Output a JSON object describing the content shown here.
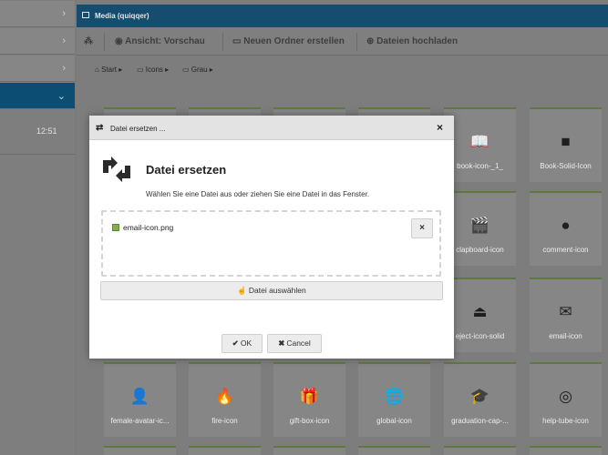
{
  "sidebar": {
    "chevron_right": "›",
    "chevron_down": "⌄",
    "time": "12:51"
  },
  "window": {
    "title": "Media (quiqqer)"
  },
  "toolbar": {
    "view_label": "Ansicht: Vorschau",
    "new_folder_label": "Neuen Ordner erstellen",
    "upload_label": "Dateien hochladen"
  },
  "breadcrumb": {
    "items": [
      "Start",
      "Icons",
      "Grau"
    ]
  },
  "tiles": [
    {
      "name": "book-icon-_1_",
      "icon": "book-open-icon",
      "glyph": "📖"
    },
    {
      "name": "Book-Solid-Icon",
      "icon": "book-solid-icon",
      "glyph": "■"
    },
    {
      "name": "clapboard-icon",
      "icon": "clapboard-icon",
      "glyph": "🎬"
    },
    {
      "name": "comment-icon",
      "icon": "comment-icon",
      "glyph": "●"
    },
    {
      "name": "eject-icon-solid",
      "icon": "eject-icon",
      "glyph": "⏏"
    },
    {
      "name": "email-icon",
      "icon": "envelope-icon",
      "glyph": "✉"
    },
    {
      "name": "female-avatar-ic...",
      "icon": "user-icon",
      "glyph": "👤"
    },
    {
      "name": "fire-icon",
      "icon": "fire-icon",
      "glyph": "🔥"
    },
    {
      "name": "gift-box-icon",
      "icon": "gift-icon",
      "glyph": "🎁"
    },
    {
      "name": "global-icon",
      "icon": "globe-icon",
      "glyph": "🌐"
    },
    {
      "name": "graduation-cap-...",
      "icon": "graduation-cap-icon",
      "glyph": "🎓"
    },
    {
      "name": "help-tube-icon",
      "icon": "lifebuoy-icon",
      "glyph": "◎"
    }
  ],
  "dialog": {
    "header_title": "Datei ersetzen ...",
    "close_symbol": "×",
    "title": "Datei ersetzen",
    "description": "Wählen Sie eine Datei aus oder ziehen Sie eine Datei in das Fenster.",
    "file_name": "email-icon.png",
    "remove_symbol": "×",
    "choose_label": "Datei auswählen",
    "ok_label": "OK",
    "cancel_label": "Cancel"
  }
}
